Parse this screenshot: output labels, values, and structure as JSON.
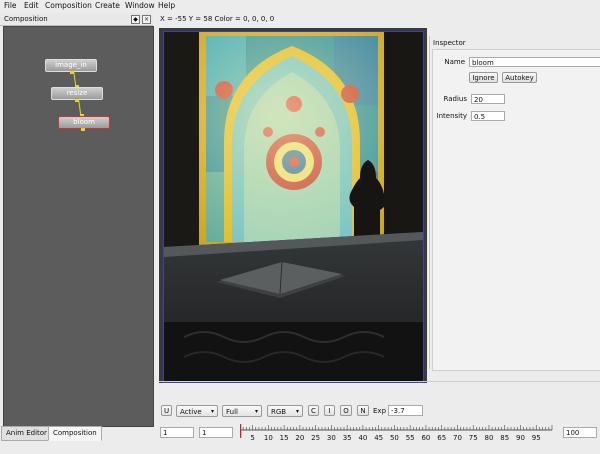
{
  "menu": [
    "File",
    "Edit",
    "Composition",
    "Create",
    "Window",
    "Help"
  ],
  "composition_panel": {
    "title": "Composition",
    "float_glyph": "◆",
    "close_glyph": "×",
    "nodes": [
      {
        "label": "image_in",
        "selected": false
      },
      {
        "label": "resize",
        "selected": false
      },
      {
        "label": "bloom",
        "selected": true
      }
    ],
    "wire_color": "#e8d81a"
  },
  "bottom_tabs": [
    {
      "label": "Anim Editor",
      "active": false
    },
    {
      "label": "Composition",
      "active": true
    }
  ],
  "viewer": {
    "coords_text": "X = -55 Y = 58 Color = 0, 0, 0, 0"
  },
  "inspector": {
    "title": "Inspector",
    "name_label": "Name",
    "name_value": "bloom",
    "ignore_button": "Ignore",
    "autokey_button": "Autokey",
    "params": [
      {
        "label": "Radius",
        "value": "20"
      },
      {
        "label": "Intensity",
        "value": "0.5"
      }
    ]
  },
  "toolbar": {
    "u_button": "U",
    "mode_combo": "Active",
    "resolution_combo": "Full",
    "channel_combo": "RGB",
    "c_button": "C",
    "i_button": "I",
    "o_button": "O",
    "n_button": "N",
    "exp_label": "Exp",
    "exp_value": "-3.7",
    "combo_arrow": "▾"
  },
  "timeline": {
    "start_frame": "1",
    "current_frame": "1",
    "end_frame": "100",
    "tick_labels": [
      "5",
      "10",
      "15",
      "20",
      "25",
      "30",
      "35",
      "40",
      "45",
      "50",
      "55",
      "60",
      "65",
      "70",
      "75",
      "80",
      "85",
      "90",
      "95"
    ],
    "min": 1,
    "max": 100,
    "playhead": 1,
    "playhead_color": "#d02020"
  }
}
